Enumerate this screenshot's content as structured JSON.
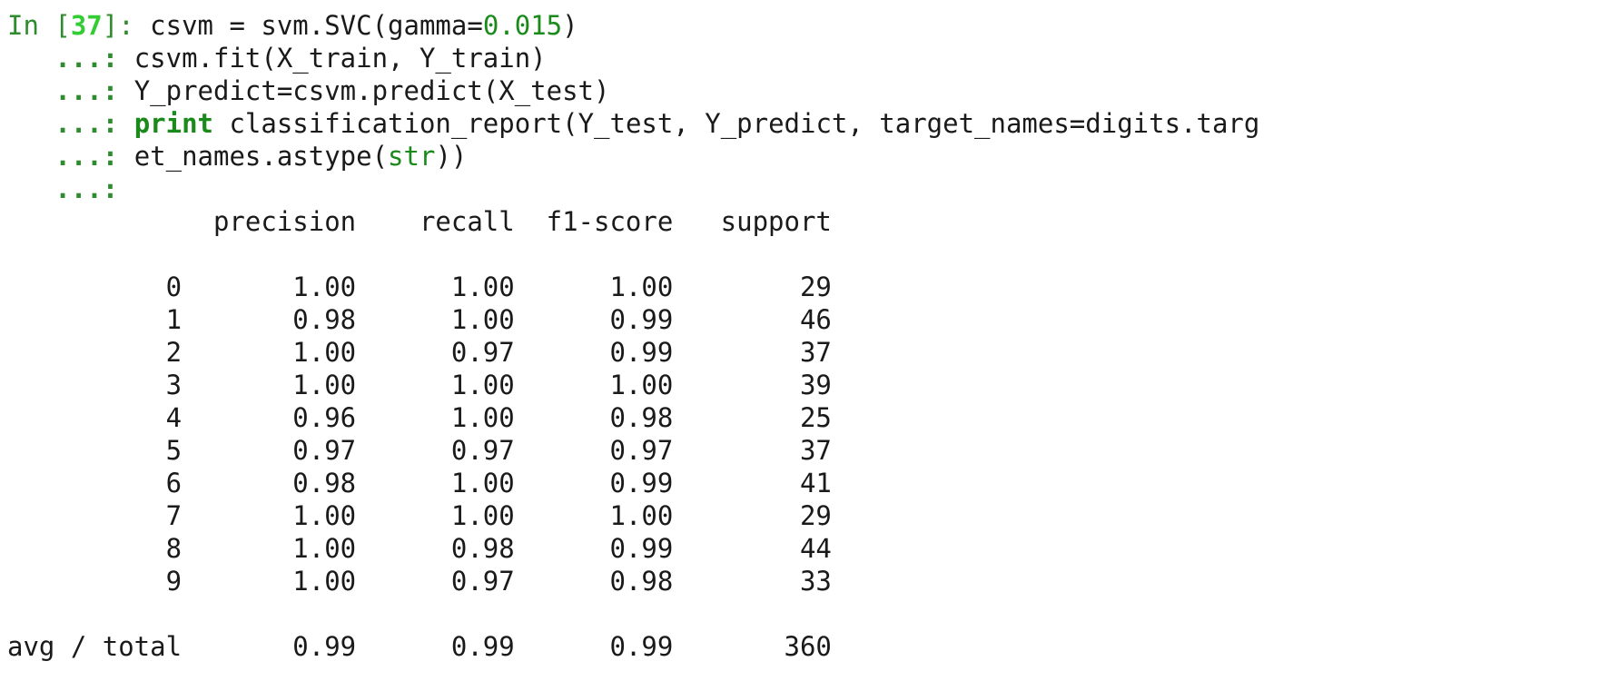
{
  "input": {
    "in_label": "In [",
    "cell_number": "37",
    "in_close": "]: ",
    "continuation": "   ...: ",
    "lines": [
      {
        "pre": "csvm = svm.SVC(gamma=",
        "num": "0.015",
        "post": ")"
      },
      {
        "text": "csvm.fit(X_train, Y_train)"
      },
      {
        "text": "Y_predict=csvm.predict(X_test)"
      },
      {
        "kw": "print",
        "text": " classification_report(Y_test, Y_predict, target_names=digits.targ"
      },
      {
        "pre": "et_names.astype(",
        "builtin": "str",
        "post": "))"
      },
      {
        "text": ""
      }
    ]
  },
  "report": {
    "header": "             precision    recall  f1-score   support",
    "rows": [
      "          0       1.00      1.00      1.00        29",
      "          1       0.98      1.00      0.99        46",
      "          2       1.00      0.97      0.99        37",
      "          3       1.00      1.00      1.00        39",
      "          4       0.96      1.00      0.98        25",
      "          5       0.97      0.97      0.97        37",
      "          6       0.98      1.00      0.99        41",
      "          7       1.00      1.00      1.00        29",
      "          8       1.00      0.98      0.99        44",
      "          9       1.00      0.97      0.98        33"
    ],
    "total": "avg / total       0.99      0.99      0.99       360"
  }
}
